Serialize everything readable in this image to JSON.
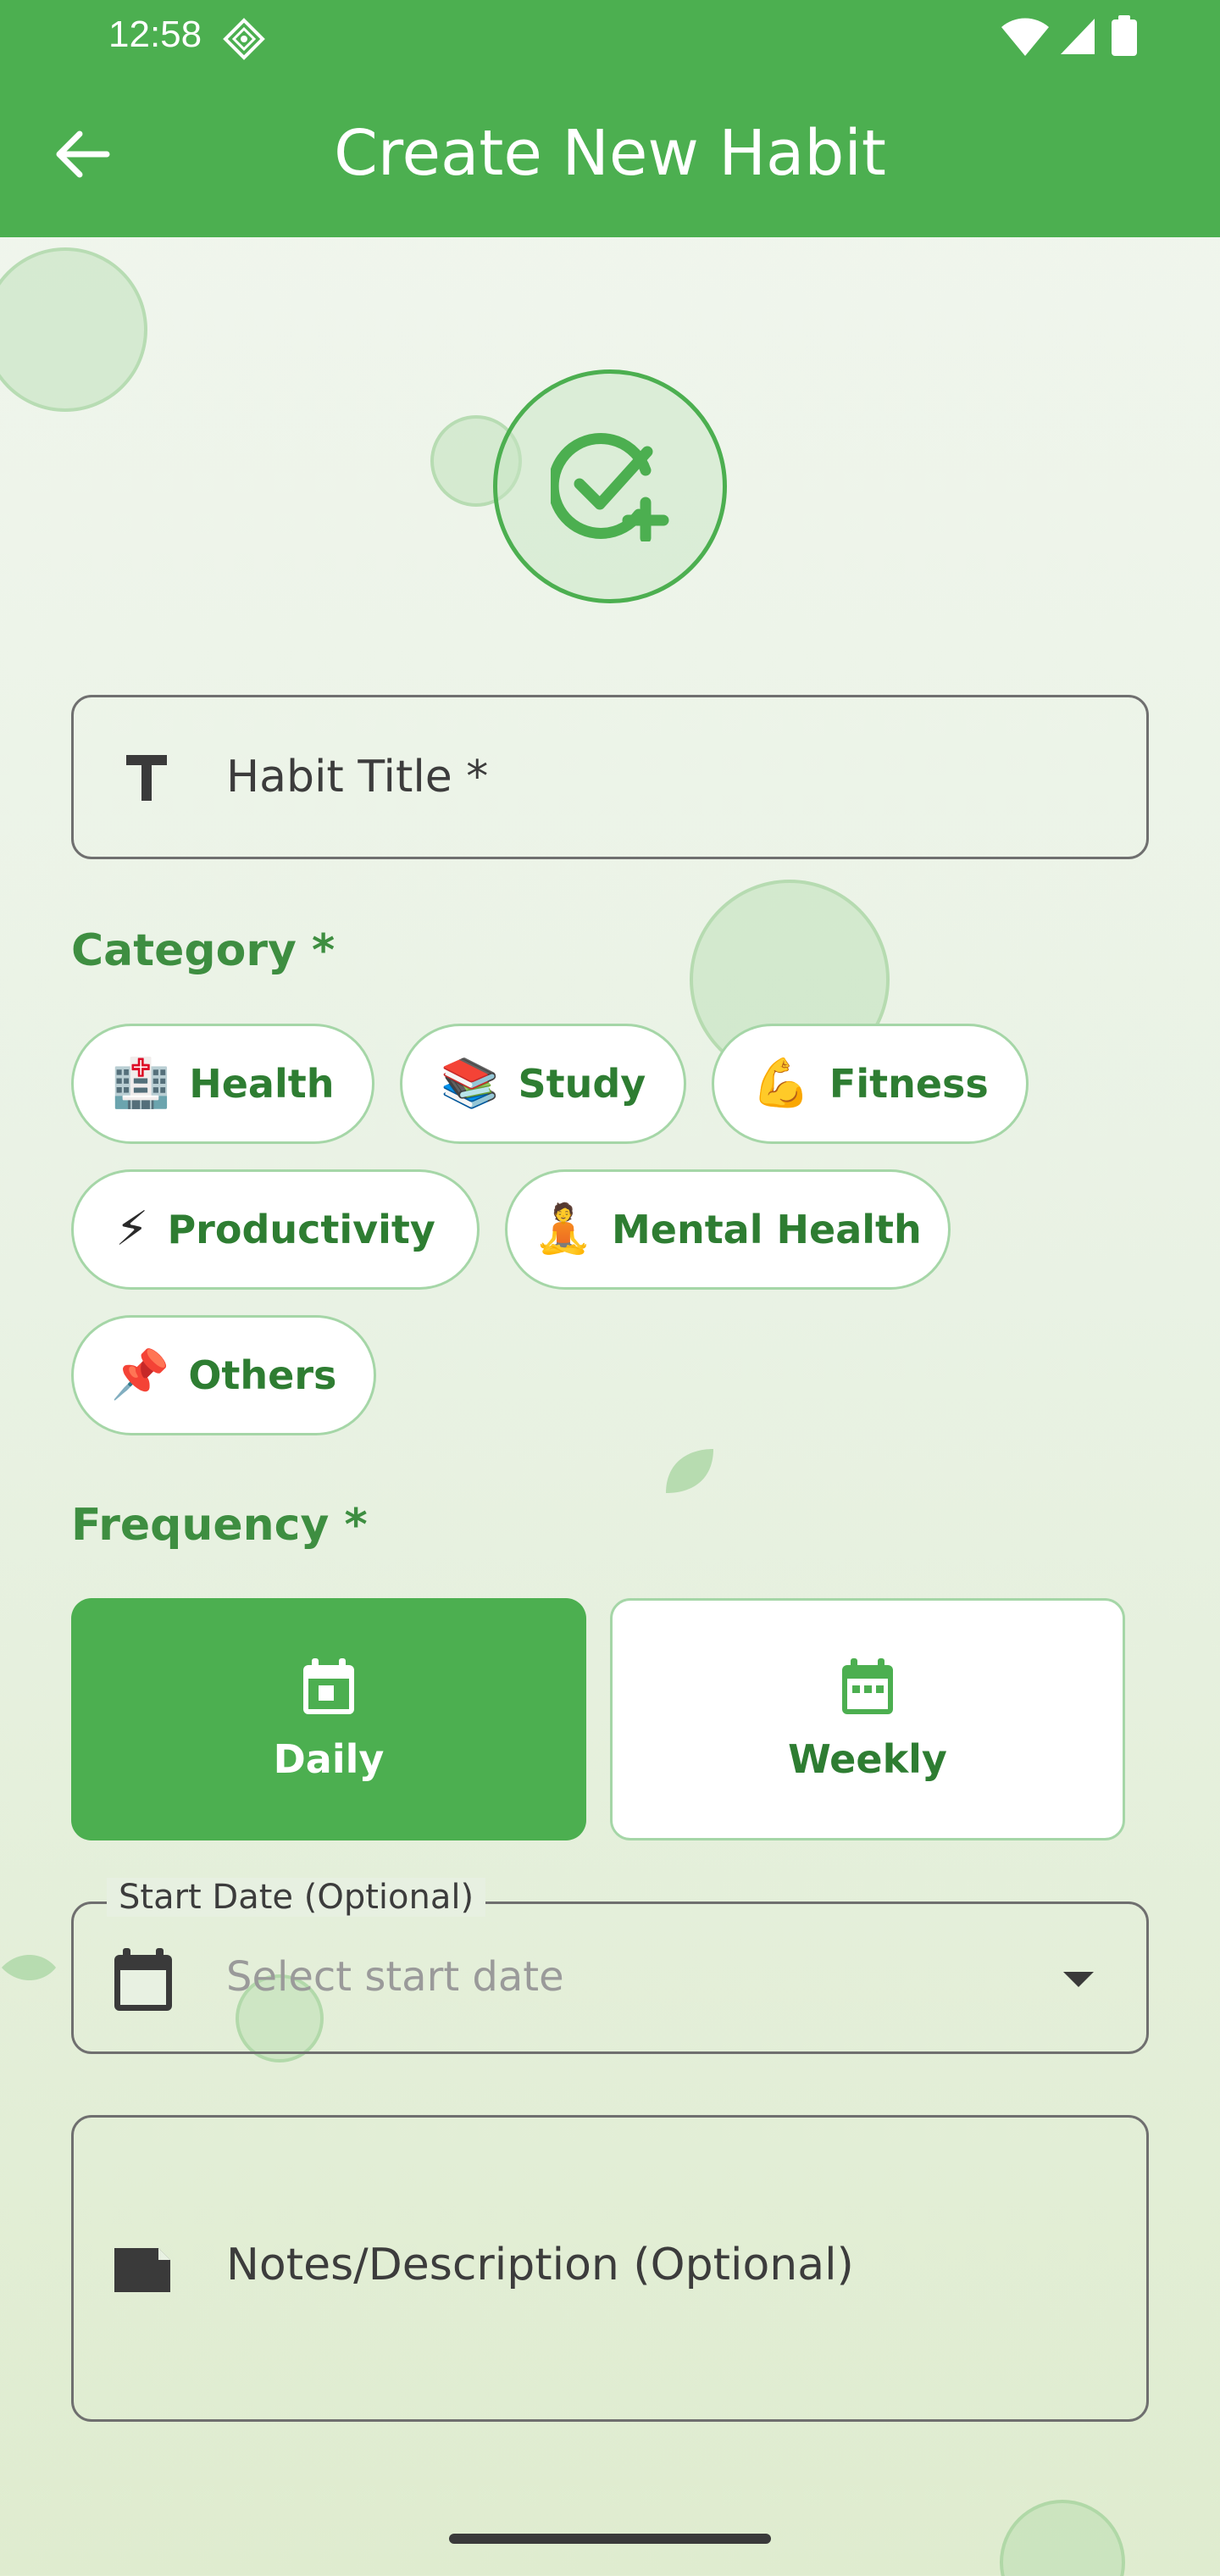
{
  "status_bar": {
    "time": "12:58"
  },
  "app_bar": {
    "title": "Create New Habit"
  },
  "form": {
    "title_field": {
      "placeholder": "Habit Title *"
    },
    "category": {
      "label": "Category *",
      "chips": [
        {
          "emoji": "🏥",
          "label": "Health"
        },
        {
          "emoji": "📚",
          "label": "Study"
        },
        {
          "emoji": "💪",
          "label": "Fitness"
        },
        {
          "emoji": "⚡",
          "label": "Productivity"
        },
        {
          "emoji": "🧘",
          "label": "Mental Health"
        },
        {
          "emoji": "📌",
          "label": "Others"
        }
      ]
    },
    "frequency": {
      "label": "Frequency *",
      "options": [
        {
          "label": "Daily",
          "selected": true
        },
        {
          "label": "Weekly",
          "selected": false
        }
      ]
    },
    "start_date": {
      "label": "Start Date (Optional)",
      "placeholder": "Select start date"
    },
    "notes": {
      "placeholder": "Notes/Description (Optional)"
    }
  },
  "colors": {
    "primary": "#4caf50",
    "primary_dark": "#2e7d32",
    "chip_border": "#a5d6a7"
  }
}
